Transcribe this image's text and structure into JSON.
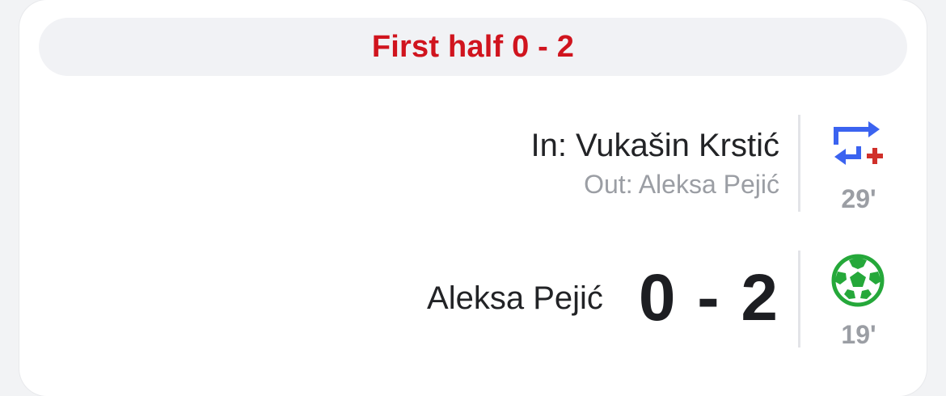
{
  "header": {
    "title": "First half 0 - 2",
    "accent_color": "#d0141e"
  },
  "events": {
    "substitution": {
      "type": "substitution",
      "player_in": "In: Vukašin Krstić",
      "player_out": "Out: Aleksa Pejić",
      "minute": "29'",
      "icon": "substitution-arrows-icon"
    },
    "goal": {
      "type": "goal",
      "scorer": "Aleksa Pejić",
      "score": "0 - 2",
      "minute": "19'",
      "icon": "football-icon"
    }
  }
}
